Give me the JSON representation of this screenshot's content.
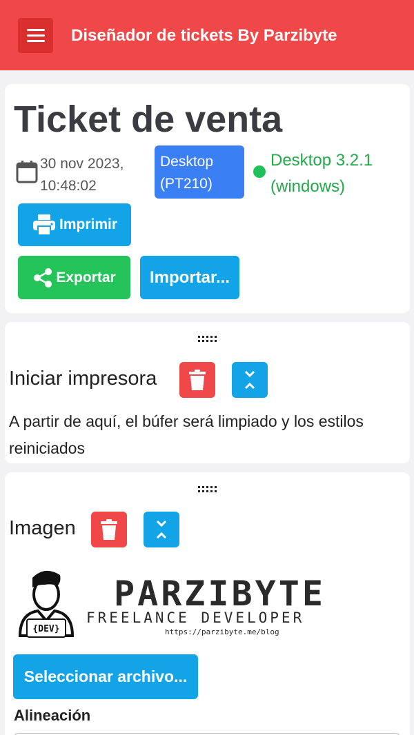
{
  "app": {
    "title": "Diseñador de tickets By Parzibyte",
    "menu_icon": "hamburger-icon",
    "header_color": "#f04848"
  },
  "ticket": {
    "title": "Ticket de venta",
    "date": "30 nov 2023,",
    "time": "10:48:02",
    "printer_line1": "Desktop",
    "printer_line2": "(PT210)",
    "plugin_line1": "Desktop 3.2.1",
    "plugin_line2": "(windows)",
    "status_color": "#22c05a",
    "buttons": {
      "print": "Imprimir",
      "export": "Exportar",
      "import": "Importar..."
    }
  },
  "sections": [
    {
      "title": "Iniciar impresora",
      "description": "A partir de aquí, el búfer será limpiado y los estilos reiniciados"
    },
    {
      "title": "Imagen",
      "logo": {
        "name": "PARZIBYTE",
        "tagline": "FREELANCE DEVELOPER",
        "url": "https://parzibyte.me/blog",
        "badge": "{DEV}"
      },
      "select_file": "Seleccionar archivo...",
      "alignment_label": "Alineación"
    }
  ],
  "colors": {
    "danger": "#f04848",
    "info": "#13a4e8",
    "success": "#25c45a",
    "primary": "#3b7ff5"
  }
}
